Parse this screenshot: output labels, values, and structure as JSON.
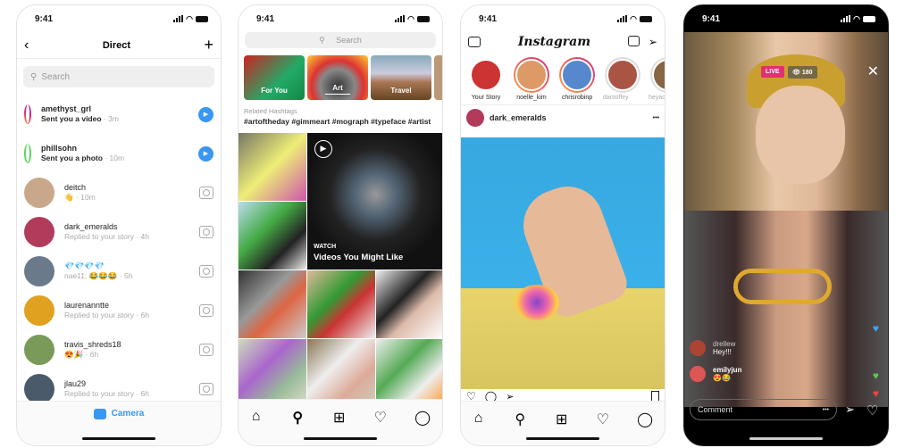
{
  "status_time": "9:41",
  "direct": {
    "title": "Direct",
    "search_placeholder": "Search",
    "footer_label": "Camera",
    "threads": [
      {
        "user": "amethyst_grl",
        "message": "Sent you a video",
        "time": "3m",
        "unread": true,
        "action": "play",
        "avatar": "#c0522a",
        "ring": "story"
      },
      {
        "user": "phillsohn",
        "message": "Sent you a photo",
        "time": "10m",
        "unread": true,
        "action": "play",
        "avatar": "#4a8a4a",
        "ring": "close"
      },
      {
        "user": "deitch",
        "message": "👋",
        "time": "10m",
        "unread": false,
        "action": "camera",
        "avatar": "#c9a78a"
      },
      {
        "user": "dark_emeralds",
        "message": "Replied to your story",
        "time": "4h",
        "unread": false,
        "action": "camera",
        "avatar": "#b23a5a"
      },
      {
        "user": "💎💎💎💎",
        "message": "nae11: 😂😂😂",
        "time": "5h",
        "unread": false,
        "action": "camera",
        "avatar": "#6a7a8a"
      },
      {
        "user": "laurenanntte",
        "message": "Replied to your story",
        "time": "6h",
        "unread": false,
        "action": "camera",
        "avatar": "#e0a020"
      },
      {
        "user": "travis_shreds18",
        "message": "😍🎉",
        "time": "6h",
        "unread": false,
        "action": "camera",
        "avatar": "#7a9a5a"
      },
      {
        "user": "jlau29",
        "message": "Replied to your story",
        "time": "6h",
        "unread": false,
        "action": "camera",
        "avatar": "#4a5a6a"
      }
    ]
  },
  "explore": {
    "search_placeholder": "Search",
    "categories": [
      "For You",
      "Art",
      "Travel"
    ],
    "selected_category": "Art",
    "related_label": "Related Hashtags",
    "hashtags": "#artoftheday #gimmeart #mograph #typeface #artist",
    "watch_label": "WATCH",
    "watch_title": "Videos You Might Like"
  },
  "feed": {
    "logo": "Instagram",
    "stories": [
      {
        "name": "Your Story",
        "seen": false,
        "own": true
      },
      {
        "name": "noelle_kim",
        "seen": false
      },
      {
        "name": "chrisrobinp",
        "seen": false
      },
      {
        "name": "dantoffey",
        "seen": true
      },
      {
        "name": "heyach",
        "seen": true
      }
    ],
    "post_user": "dark_emeralds",
    "more": "•••"
  },
  "live": {
    "badge": "LIVE",
    "viewers": "180",
    "comments": [
      {
        "user": "drellew",
        "text": "Hey!!!"
      },
      {
        "user": "emilyjun",
        "text": "😍😂"
      }
    ],
    "comment_placeholder": "Comment",
    "more": "•••"
  }
}
